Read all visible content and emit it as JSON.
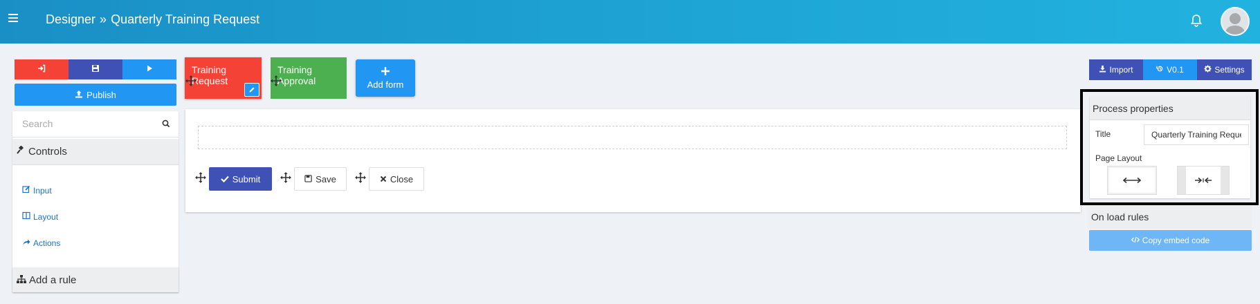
{
  "header": {
    "app": "Designer",
    "separator": "»",
    "process": "Quarterly Training Request"
  },
  "colors": {
    "red": "#f44336",
    "indigo": "#3f51b5",
    "green": "#4caf50",
    "blue": "#2196f3",
    "header": "#1ea6d6"
  },
  "left": {
    "publish_label": "Publish",
    "search_placeholder": "Search",
    "controls_title": "Controls",
    "items": [
      {
        "label": "Input",
        "icon": "edit-icon"
      },
      {
        "label": "Layout",
        "icon": "columns-icon"
      },
      {
        "label": "Actions",
        "icon": "share-icon"
      }
    ],
    "add_rule": "Add a rule"
  },
  "forms": [
    {
      "label": "Training Request",
      "color": "#f44336"
    },
    {
      "label": "Training Approval",
      "color": "#4caf50"
    }
  ],
  "add_form": "Add form",
  "canvas": {
    "submit": "Submit",
    "save": "Save",
    "close": "Close"
  },
  "right": {
    "import": "Import",
    "version": "V0.1",
    "settings": "Settings",
    "properties_title": "Process properties",
    "title_label": "Title",
    "title_value": "Quarterly Training Reque",
    "page_layout_label": "Page Layout",
    "on_load_rules": "On load rules",
    "copy_embed": "Copy embed code"
  }
}
